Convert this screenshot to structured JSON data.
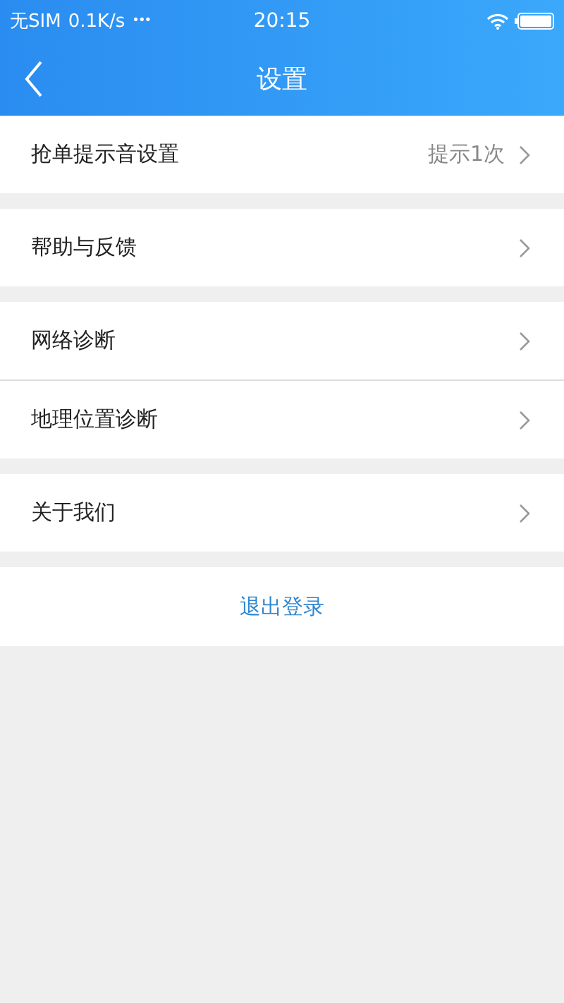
{
  "status_bar": {
    "carrier": "无SIM",
    "speed": "0.1K/s",
    "more": "•••",
    "time": "20:15"
  },
  "header": {
    "title": "设置"
  },
  "groups": [
    {
      "items": [
        {
          "label": "抢单提示音设置",
          "value": "提示1次"
        }
      ]
    },
    {
      "items": [
        {
          "label": "帮助与反馈"
        }
      ]
    },
    {
      "items": [
        {
          "label": "网络诊断"
        },
        {
          "label": "地理位置诊断"
        }
      ]
    },
    {
      "items": [
        {
          "label": "关于我们"
        }
      ]
    }
  ],
  "logout": {
    "label": "退出登录"
  }
}
